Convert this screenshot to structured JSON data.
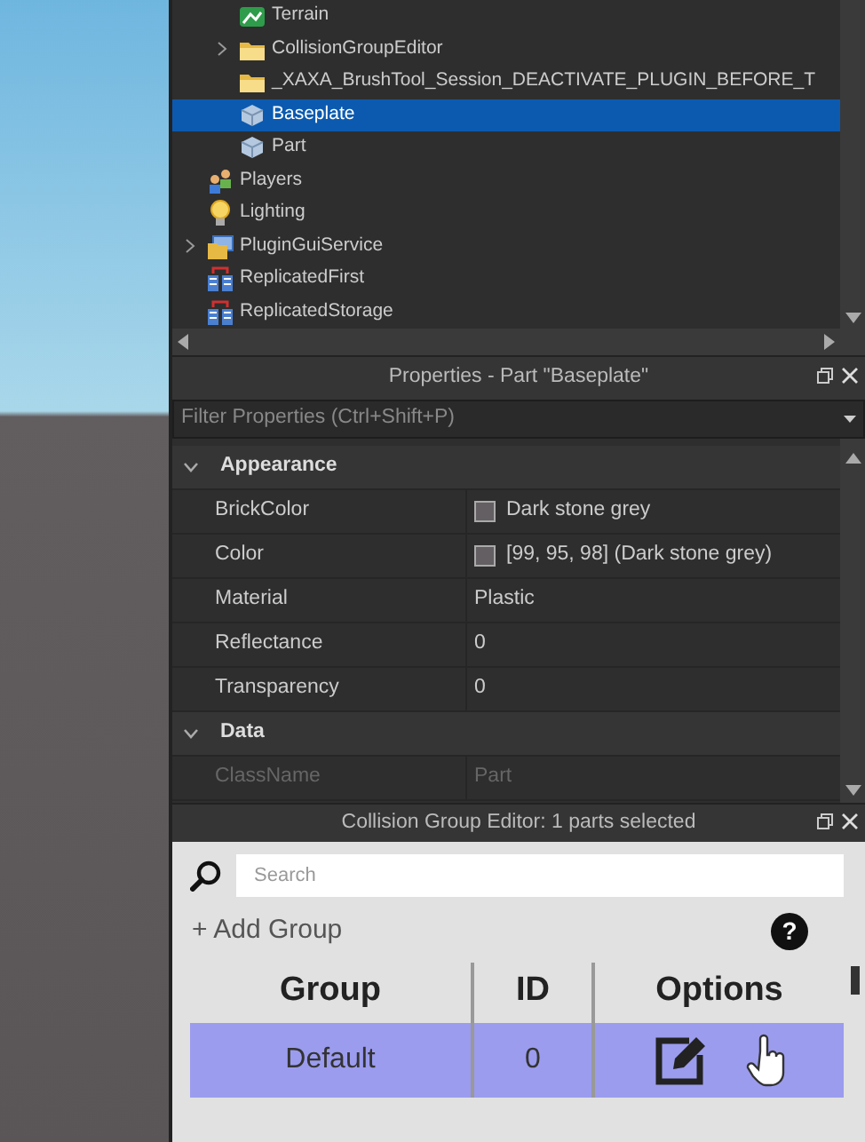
{
  "explorer": {
    "items": [
      {
        "children": [
          {
            "label": "Terrain",
            "kind": "terrain",
            "expandable": false,
            "selected": false
          },
          {
            "label": "CollisionGroupEditor",
            "kind": "folder",
            "expandable": true,
            "selected": false
          },
          {
            "label": "_XAXA_BrushTool_Session_DEACTIVATE_PLUGIN_BEFORE_T",
            "kind": "folder",
            "expandable": false,
            "selected": false
          },
          {
            "label": "Baseplate",
            "kind": "part",
            "expandable": false,
            "selected": true
          },
          {
            "label": "Part",
            "kind": "part",
            "expandable": false,
            "selected": false
          }
        ]
      },
      {
        "label": "Players",
        "kind": "players",
        "expandable": false,
        "selected": false
      },
      {
        "label": "Lighting",
        "kind": "lighting",
        "expandable": false,
        "selected": false
      },
      {
        "label": "PluginGuiService",
        "kind": "window",
        "expandable": true,
        "selected": false
      },
      {
        "label": "ReplicatedFirst",
        "kind": "replicated",
        "expandable": false,
        "selected": false
      },
      {
        "label": "ReplicatedStorage",
        "kind": "replicated",
        "expandable": false,
        "selected": false
      }
    ]
  },
  "properties": {
    "title": "Properties - Part \"Baseplate\"",
    "filter": {
      "placeholder": "Filter Properties (Ctrl+Shift+P)"
    },
    "sections": [
      {
        "name": "Appearance",
        "expanded": true,
        "rows": [
          {
            "name": "BrickColor",
            "value": "Dark stone grey",
            "color": "#635f62",
            "disabled": false
          },
          {
            "name": "Color",
            "value": "[99, 95, 98] (Dark stone grey)",
            "color": "#635f62",
            "disabled": false
          },
          {
            "name": "Material",
            "value": "Plastic",
            "disabled": false
          },
          {
            "name": "Reflectance",
            "value": "0",
            "disabled": false
          },
          {
            "name": "Transparency",
            "value": "0",
            "disabled": false
          }
        ]
      },
      {
        "name": "Data",
        "expanded": true,
        "rows": [
          {
            "name": "ClassName",
            "value": "Part",
            "disabled": true
          }
        ]
      }
    ]
  },
  "collision_editor": {
    "title": "Collision Group Editor: 1 parts selected",
    "search": {
      "placeholder": "Search"
    },
    "add_group": "+ Add Group",
    "help": "?",
    "columns": [
      "Group",
      "ID",
      "Options"
    ],
    "rows": [
      {
        "group": "Default",
        "id": "0",
        "selected": true
      }
    ]
  }
}
